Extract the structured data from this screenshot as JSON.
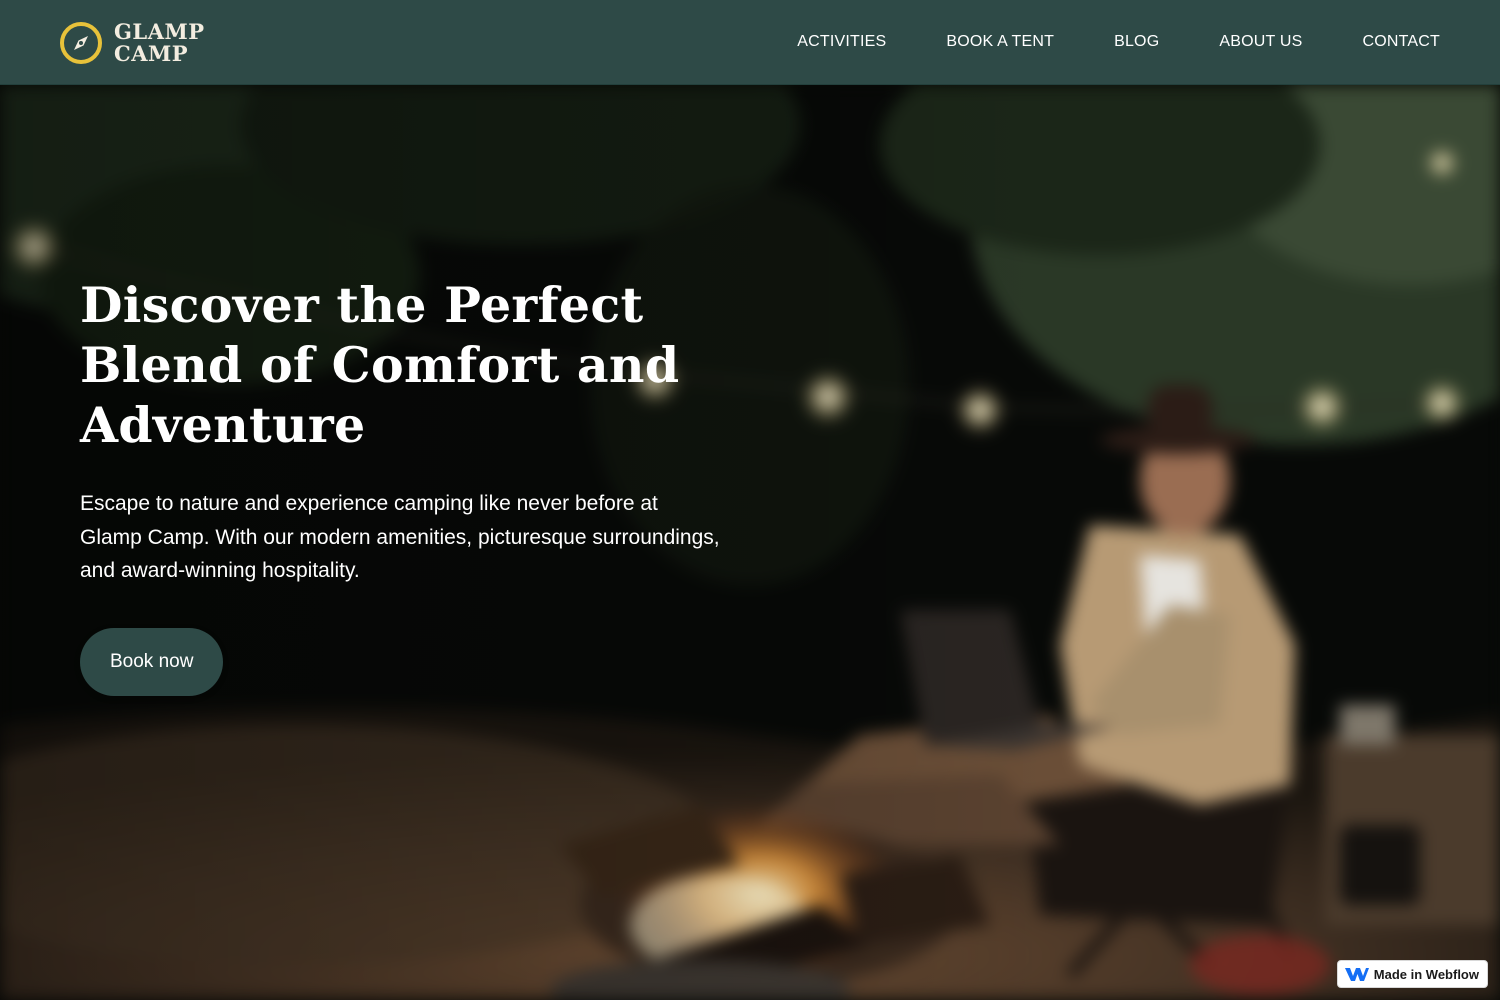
{
  "brand": {
    "line1": "GLAMP",
    "line2": "CAMP",
    "icon": "compass-icon",
    "colors": {
      "header_bg": "#2e4a47",
      "accent": "#e8c23a",
      "text": "#f3ede0"
    }
  },
  "nav": {
    "items": [
      {
        "label": "ACTIVITIES"
      },
      {
        "label": "BOOK A TENT"
      },
      {
        "label": "BLOG"
      },
      {
        "label": "ABOUT US"
      },
      {
        "label": "CONTACT"
      }
    ]
  },
  "hero": {
    "heading": "Discover the Perfect Blend of Comfort and Adventure",
    "body": "Escape to nature and experience camping like never before at Glamp Camp. With our modern amenities, picturesque surroundings, and award-winning hospitality.",
    "cta_label": "Book now",
    "colors": {
      "cta_bg": "#2e4a47",
      "text": "#ffffff"
    }
  },
  "badge": {
    "label": "Made in Webflow",
    "icon": "webflow-logo-icon",
    "colors": {
      "logo": "#146ef5"
    }
  }
}
